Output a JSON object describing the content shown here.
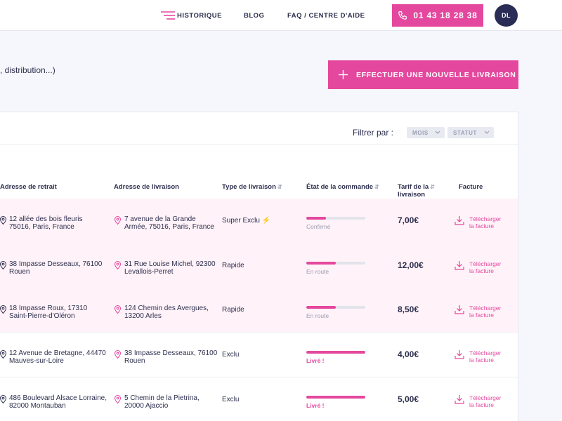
{
  "header": {
    "nav": [
      "HISTORIQUE",
      "BLOG",
      "FAQ / CENTRE D'AIDE"
    ],
    "phone": "01 43 18 28 38",
    "avatar_initials": "DL"
  },
  "page": {
    "subtitle": ", distribution...)",
    "new_delivery_label": "EFFECTUER UNE NOUVELLE LIVRAISON"
  },
  "filters": {
    "label": "Filtrer par :",
    "month": "MOIS",
    "status": "STATUT"
  },
  "table": {
    "headers": {
      "pickup": "Adresse de retrait",
      "delivery": "Adresse de livraison",
      "type": "Type de livraison",
      "state": "État de la commande",
      "price_line1": "Tarif de la",
      "price_line2": "livraison",
      "invoice": "Facture"
    },
    "download_line1": "Télécharger",
    "download_line2": "la facture",
    "rows": [
      {
        "pickup1": "12 allée des bois fleuris",
        "pickup2": "75016, Paris, France",
        "delivery1": "7 avenue de la Grande",
        "delivery2": "Armée, 75016, Paris, France",
        "type": "Super Exclu",
        "status": "Confirmé",
        "progress": 0.33,
        "price": "7,00€",
        "highlight": true
      },
      {
        "pickup1": "38 Impasse Desseaux, 76100",
        "pickup2": "Rouen",
        "delivery1": "31 Rue Louise Michel, 92300",
        "delivery2": "Levallois-Perret",
        "type": "Rapide",
        "status": "En route",
        "progress": 0.5,
        "price": "12,00€",
        "highlight": true
      },
      {
        "pickup1": "18 Impasse Roux, 17310",
        "pickup2": "Saint-Pierre-d'Oléron",
        "delivery1": "124 Chemin des Avergues,",
        "delivery2": "13200 Arles",
        "type": "Rapide",
        "status": "En route",
        "progress": 0.5,
        "price": "8,50€",
        "highlight": true
      },
      {
        "pickup1": "12 Avenue de Bretagne, 44470",
        "pickup2": "Mauves-sur-Loire",
        "delivery1": "38 Impasse Desseaux, 76100",
        "delivery2": "Rouen",
        "type": "Exclu",
        "status": "Livré !",
        "progress": 1.0,
        "price": "4,00€",
        "highlight": false
      },
      {
        "pickup1": "486 Boulevard Alsace Lorraine,",
        "pickup2": "82000 Montauban",
        "delivery1": "5 Chemin de la Pietrina,",
        "delivery2": "20000 Ajaccio",
        "type": "Exclu",
        "status": "Livré !",
        "progress": 1.0,
        "price": "5,00€",
        "highlight": false
      }
    ]
  },
  "colors": {
    "accent": "#e4489e",
    "dark": "#2d2f4e",
    "avatar_bg": "#2a2c56",
    "row_highlight": "#fff2f8"
  }
}
